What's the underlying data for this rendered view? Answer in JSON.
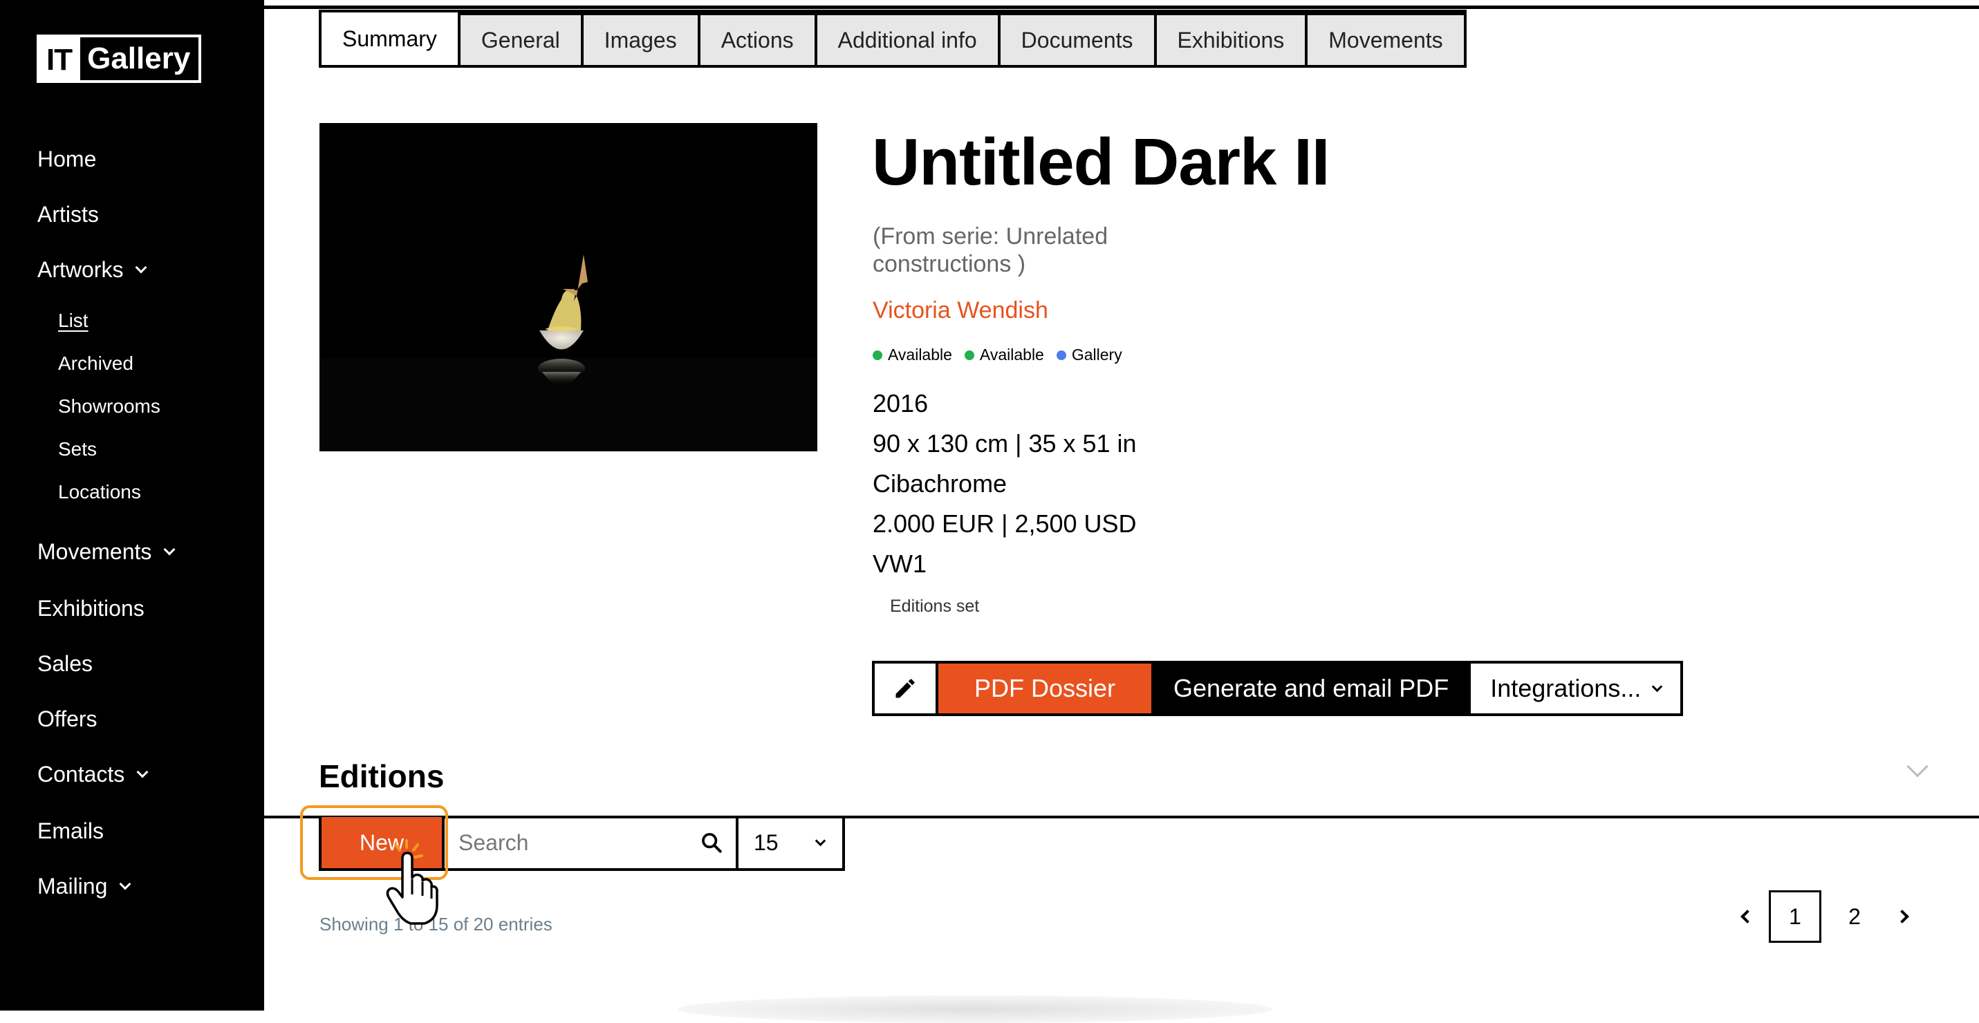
{
  "sidebar": {
    "logo_it": "IT",
    "logo_gallery": "Gallery",
    "items": {
      "home": "Home",
      "artists": "Artists",
      "artworks": "Artworks",
      "movements": "Movements",
      "exhibitions": "Exhibitions",
      "sales": "Sales",
      "offers": "Offers",
      "contacts": "Contacts",
      "emails": "Emails",
      "mailing": "Mailing"
    },
    "artworks_sub": {
      "list": "List",
      "archived": "Archived",
      "showrooms": "Showrooms",
      "sets": "Sets",
      "locations": "Locations"
    }
  },
  "tabs": [
    "Summary",
    "General",
    "Images",
    "Actions",
    "Additional info",
    "Documents",
    "Exhibitions",
    "Movements"
  ],
  "artwork": {
    "title": "Untitled Dark II",
    "serie": "(From serie: Unrelated constructions )",
    "artist": "Victoria Wendish",
    "badges": [
      {
        "label": "Available",
        "color": "#22b14c"
      },
      {
        "label": "Available",
        "color": "#22b14c"
      },
      {
        "label": "Gallery",
        "color": "#4a7de8"
      }
    ],
    "year": "2016",
    "dimensions": "90 x 130 cm | 35 x 51 in",
    "technique": "Cibachrome",
    "price": "2.000 EUR | 2,500 USD",
    "reference": "VW1",
    "editions_set": "Editions set"
  },
  "actions": {
    "edit_icon": "pencil-icon",
    "pdf_dossier": "PDF Dossier",
    "generate_email": "Generate and email PDF",
    "integrations": "Integrations..."
  },
  "editions": {
    "title": "Editions",
    "new_button": "New",
    "search_placeholder": "Search",
    "per_page": "15",
    "showing": "Showing 1 to 15 of 20 entries",
    "pages": [
      "1",
      "2"
    ],
    "current_page": "1"
  },
  "colors": {
    "accent": "#e8521f",
    "highlight": "#f39a1e",
    "available": "#22b14c",
    "gallery": "#4a7de8"
  }
}
